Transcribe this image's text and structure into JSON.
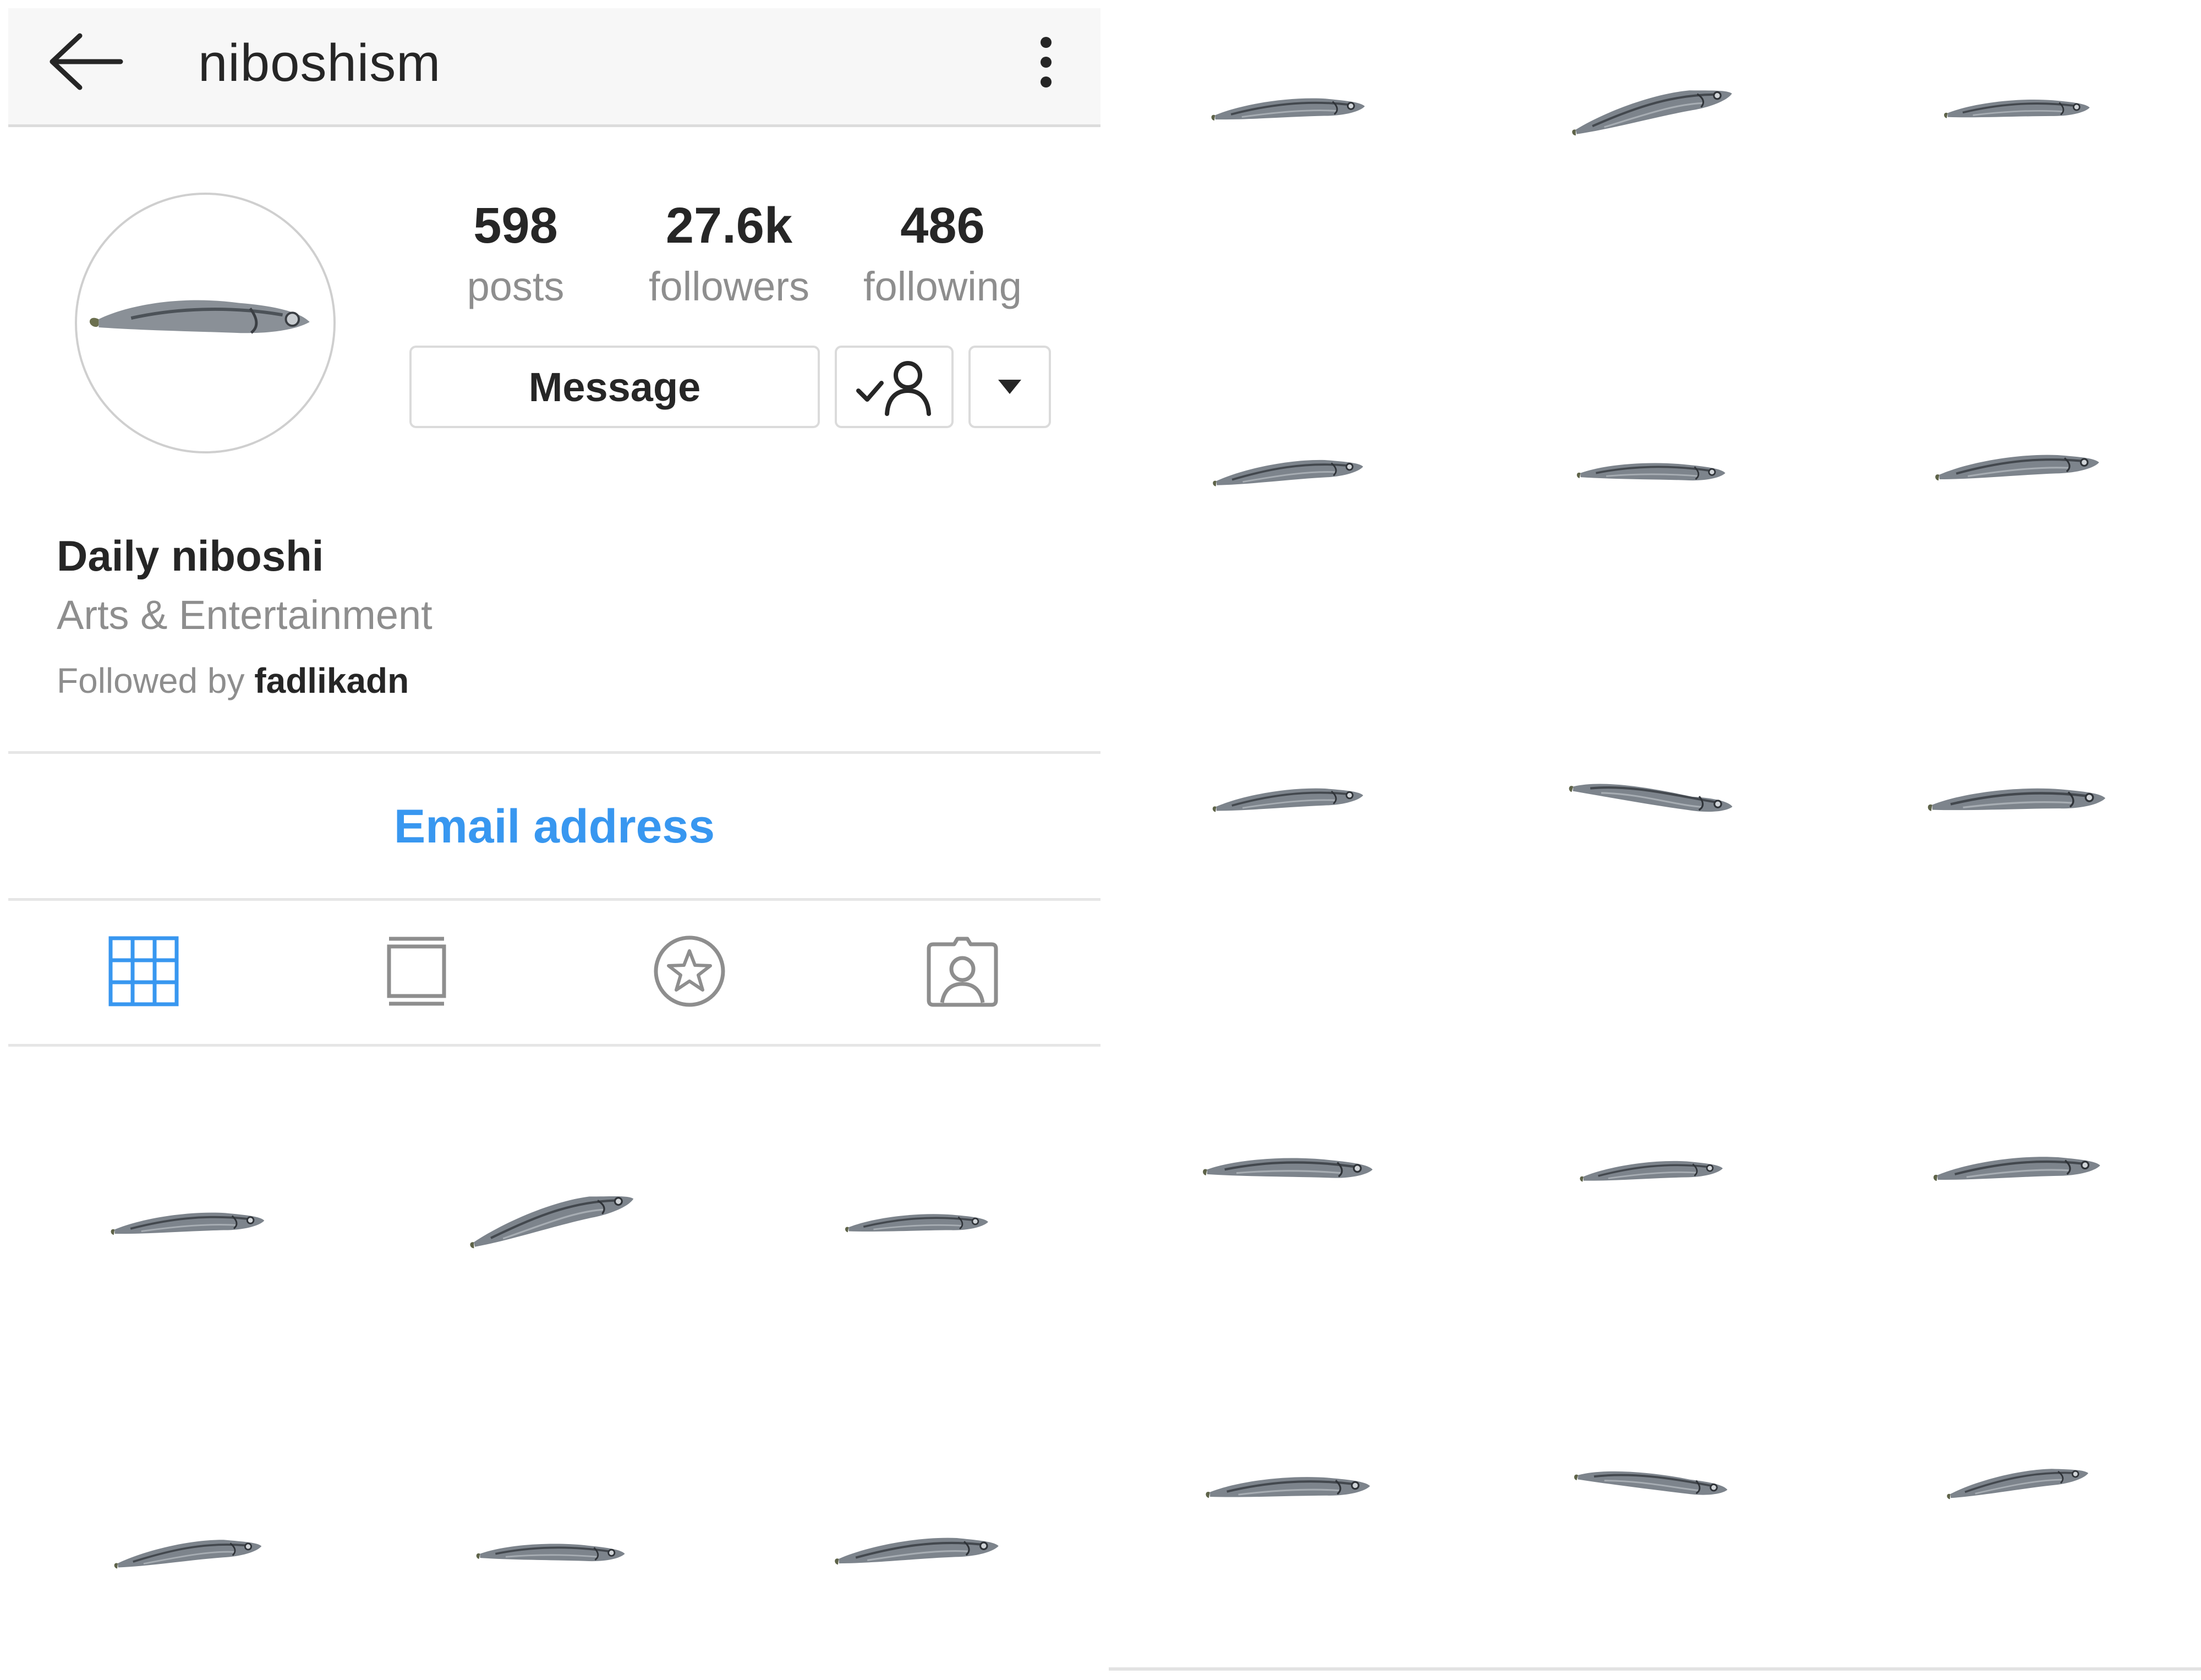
{
  "header": {
    "username": "niboshism"
  },
  "stats": [
    {
      "value": "598",
      "label": "posts"
    },
    {
      "value": "27.6k",
      "label": "followers"
    },
    {
      "value": "486",
      "label": "following"
    }
  ],
  "actions": {
    "message_label": "Message"
  },
  "bio": {
    "name": "Daily niboshi",
    "category": "Arts & Entertainment",
    "followed_by_prefix": "Followed by",
    "followed_by_user": "fadlikadn"
  },
  "contact": {
    "email_label": "Email address"
  },
  "tabs": [
    {
      "icon": "grid-icon",
      "active": true
    },
    {
      "icon": "feed-icon",
      "active": false
    },
    {
      "icon": "tagged-star-icon",
      "active": false
    },
    {
      "icon": "tagged-photos-icon",
      "active": false
    }
  ],
  "colors": {
    "link_blue": "#3897f0",
    "text_primary": "#262626",
    "text_secondary": "#8e8e8e",
    "header_bg": "#f7f7f7"
  },
  "posts_left_count": 6,
  "posts_right_count": 15
}
